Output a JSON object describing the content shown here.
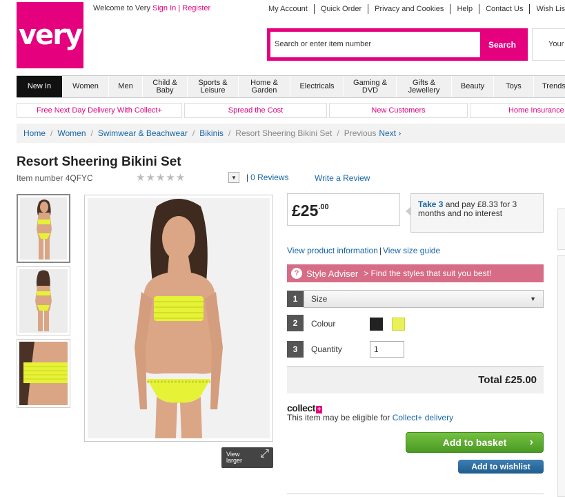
{
  "header": {
    "logo_text": "very",
    "welcome": "Welcome to Very",
    "sign_in": "Sign In",
    "register": "Register",
    "top_links": [
      "My Account",
      "Quick Order",
      "Privacy and Cookies",
      "Help",
      "Contact Us",
      "Wish List"
    ],
    "search_placeholder": "Search or enter item number",
    "search_button": "Search",
    "account_text": "Your",
    "brand_color": "#e5007e"
  },
  "nav": {
    "items": [
      "New In",
      "Women",
      "Men",
      "Child & Baby",
      "Sports & Leisure",
      "Home & Garden",
      "Electricals",
      "Gaming & DVD",
      "Gifts & Jewellery",
      "Beauty",
      "Toys",
      "Trends"
    ],
    "active": "New In"
  },
  "promos": [
    "Free Next Day Delivery With Collect+",
    "Spread the Cost",
    "New Customers",
    "Home Insurance"
  ],
  "breadcrumb": {
    "items": [
      "Home",
      "Women",
      "Swimwear & Beachwear",
      "Bikinis"
    ],
    "current": "Resort Sheering Bikini Set",
    "previous": "Previous",
    "next": "Next ›"
  },
  "product": {
    "title": "Resort Sheering Bikini Set",
    "item_number": "Item number 4QFYC",
    "stars": "★★★★★",
    "rating_count": 0,
    "reviews": "0 Reviews",
    "write_review": "Write a Review",
    "view_larger": "View larger",
    "price_main": "£25",
    "price_pence": ".00",
    "take3_highlight": "Take 3",
    "take3_text": " and pay £8.33 for 3 months and no interest",
    "view_info": "View product information",
    "view_size": "View size guide",
    "style_adviser": "Style Adviser",
    "style_adviser_sub": "> Find the styles that suit you best!",
    "steps": [
      "1",
      "2",
      "3"
    ],
    "size_label": "Size",
    "colour_label": "Colour",
    "colours": [
      "#222222",
      "#e9f15a"
    ],
    "quantity_label": "Quantity",
    "quantity_value": "1",
    "total": "Total £25.00",
    "collect_logo": "collect",
    "collect_plus": "+",
    "collect_msg": "This item may be eligible for ",
    "collect_link": "Collect+ delivery",
    "add_basket": "Add to basket",
    "add_wishlist": "Add to wishlist"
  }
}
